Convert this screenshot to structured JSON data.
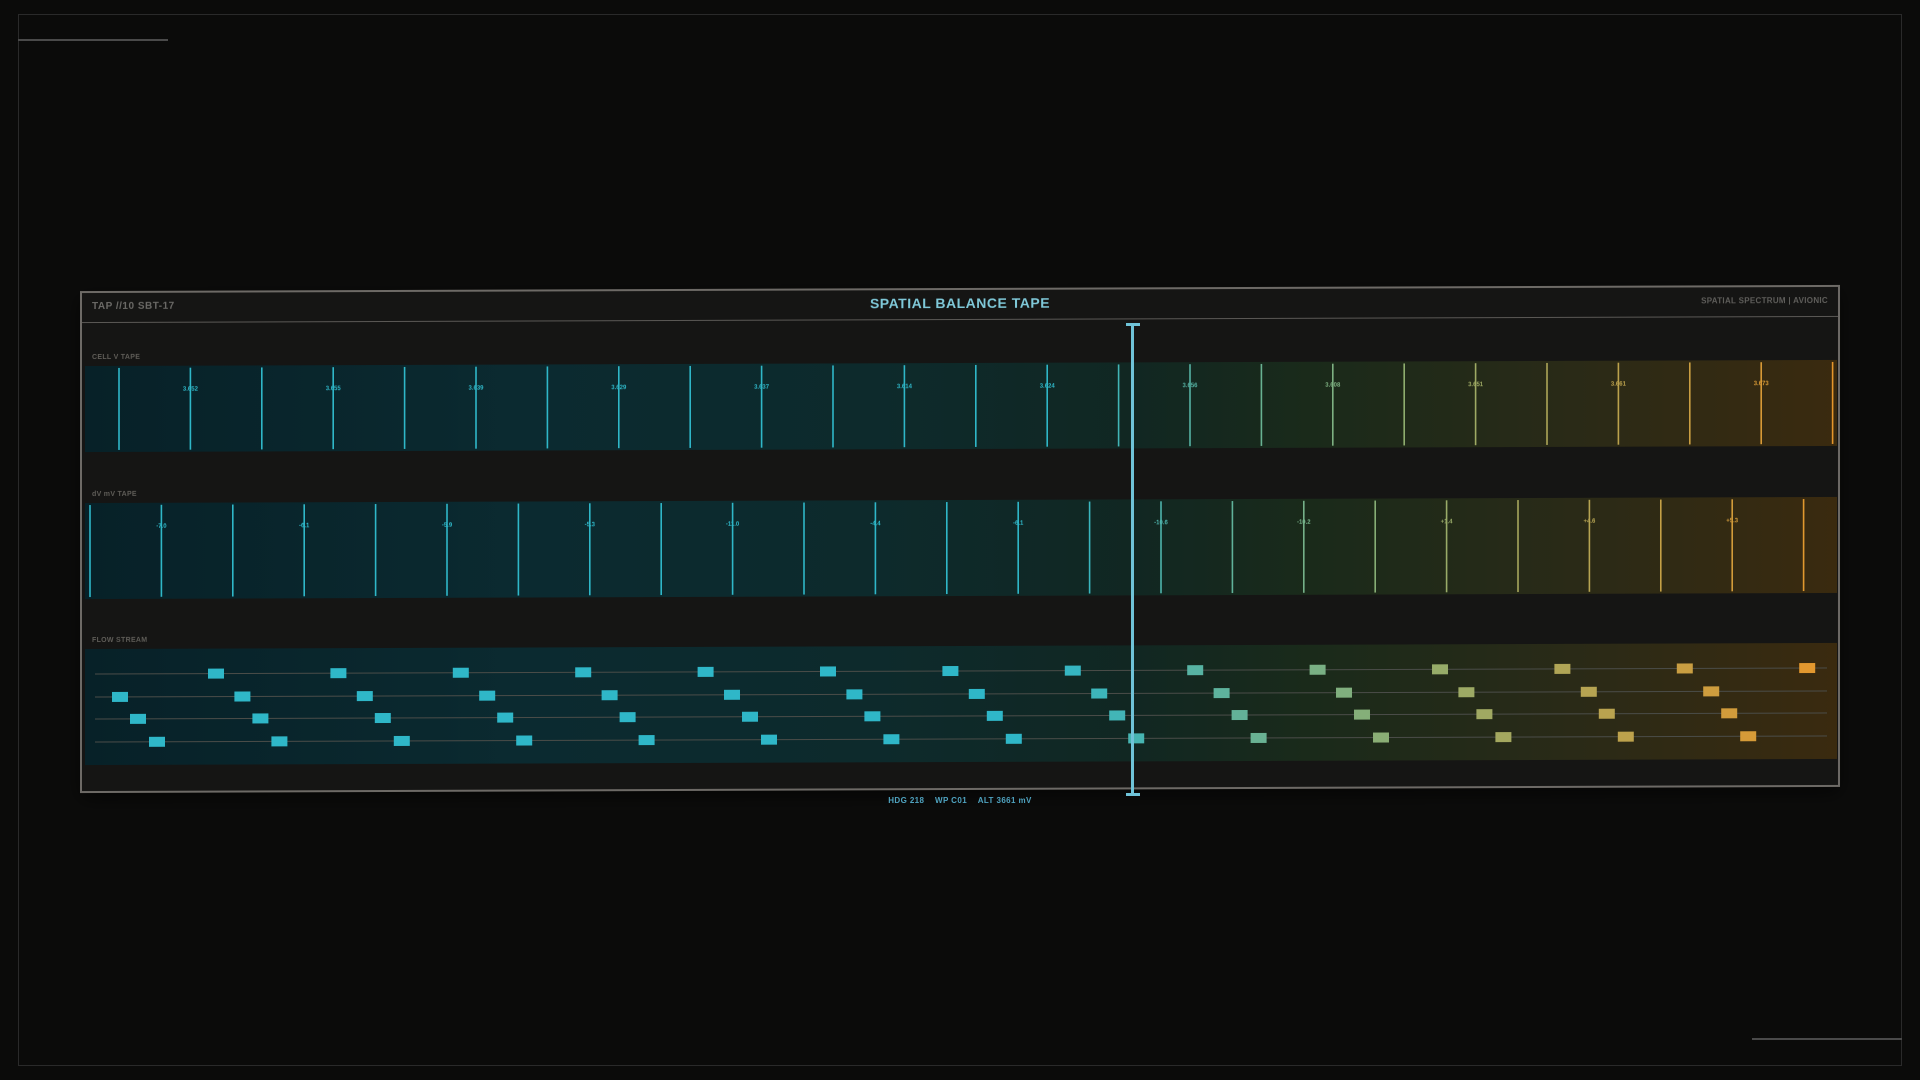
{
  "panel": {
    "id_label": "TAP //10 SBT-17",
    "title": "SPATIAL BALANCE TAPE",
    "right_info": "SPATIAL SPECTRUM | AVIONIC"
  },
  "cell_v_tape": {
    "label": "CELL V TAPE",
    "ticks": [
      "3.652",
      "3.655",
      "3.639",
      "3.629",
      "3.637",
      "3.614",
      "3.624",
      "3.656",
      "3.608",
      "3.651",
      "3.661",
      "3.673"
    ]
  },
  "dv_tape": {
    "label": "dV mV TAPE",
    "ticks": [
      "-7.0",
      "-6.1",
      "-5.9",
      "-5.3",
      "-11.0",
      "-4.4",
      "-6.1",
      "-10.6",
      "-10.2",
      "+1.4",
      "+4.6",
      "+5.3"
    ]
  },
  "flow_stream": {
    "label": "FLOW STREAM",
    "rows": 4
  },
  "readout": {
    "hdg": "HDG 218",
    "wp": "WP C01",
    "alt": "ALT 3661 mV"
  },
  "colors": {
    "teal": "#2fb7c8",
    "green": "#8fae70",
    "amber": "#e8962a",
    "cursor": "#6fc3d8"
  }
}
